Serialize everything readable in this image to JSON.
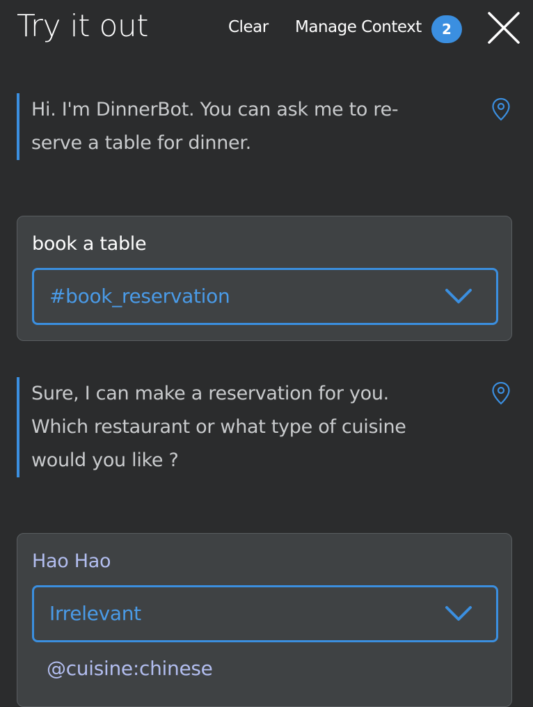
{
  "header": {
    "title": "Try it out",
    "clear_label": "Clear",
    "manage_context_label": "Manage Context",
    "context_count": "2"
  },
  "conversation": {
    "bot_message_1": {
      "lines": [
        "Hi. I'm DinnerBot. You can ask me to re-",
        "serve a table for dinner."
      ]
    },
    "user_message_1": {
      "text": "book a table",
      "intent": "#book_reservation"
    },
    "bot_message_2": {
      "lines": [
        "Sure, I can make a reservation for you.",
        "Which restaurant or what type of cuisine",
        "would you like ?"
      ]
    },
    "user_message_2": {
      "text": "Hao Hao",
      "intent": "Irrelevant",
      "entity": "@cuisine:chinese"
    }
  },
  "colors": {
    "background": "#2b2c2d",
    "accent": "#3b8fe0",
    "card": "#3f4244",
    "entity_text": "#b3bef0"
  },
  "icons": {
    "close": "close-icon",
    "pin": "location-pin-icon",
    "chevron": "chevron-down-icon"
  }
}
